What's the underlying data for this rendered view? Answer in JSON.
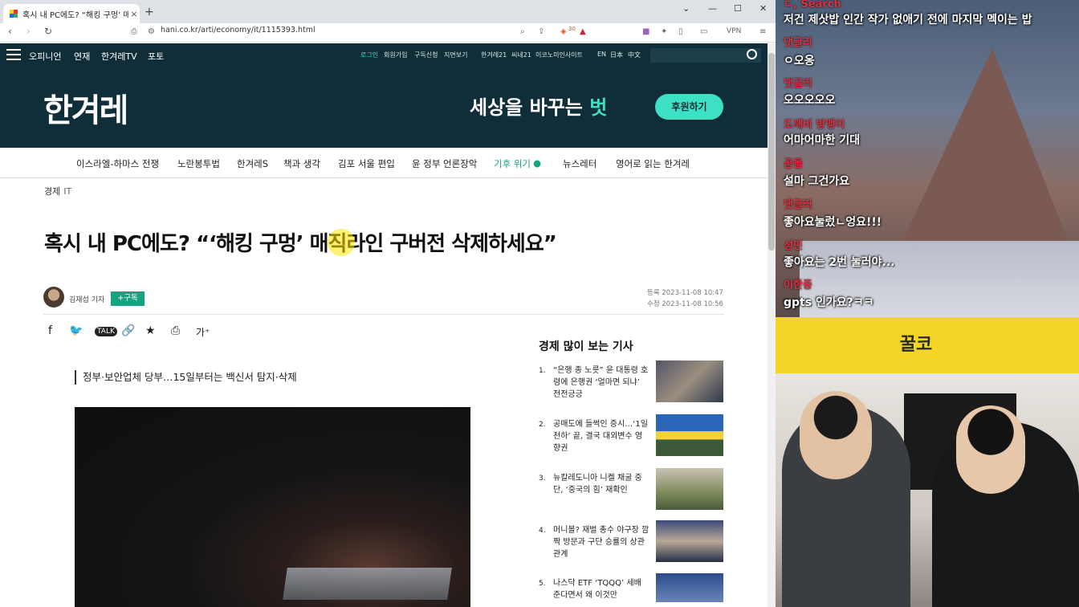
{
  "browser": {
    "tab_title": "혹시 내 PC에도? “해킹 구멍’ 매직…",
    "url": "hani.co.kr/arti/economy/it/1115393.html",
    "vpn": "VPN",
    "shield_count": "30"
  },
  "gnb": {
    "left": [
      "오피니언",
      "연재",
      "한겨레TV",
      "포토"
    ],
    "right": [
      "로그인",
      "회원가입",
      "구독신청",
      "지면보기",
      "한겨레21",
      "씨네21",
      "이코노미인사이트",
      "EN",
      "日本",
      "中文"
    ]
  },
  "masthead": {
    "logo": "한겨레",
    "slogan_pre": "세상을 바꾸는 ",
    "slogan_em": "벗",
    "support": "후원하기"
  },
  "catnav": [
    "이스라엘-하마스 전쟁",
    "노란봉투법",
    "한겨레S",
    "책과 생각",
    "김포 서울 편입",
    "윤 정부 언론장악",
    "기후 위기",
    "뉴스레터",
    "영어로 읽는 한겨레"
  ],
  "article": {
    "section": "경제",
    "subsection": "IT",
    "title": "혹시 내 PC에도? “‘해킹 구멍’ 매직라인 구버전 삭제하세요”",
    "reporter": "김재섭 기자",
    "subscribe": "+구독",
    "registered": "등록 2023-11-08 10:47",
    "modified": "수정 2023-11-08 10:56",
    "subhead": "정부·보안업체 당부…15일부터는 백신서 탐지·삭제",
    "font_btn": "가⁺"
  },
  "sidebar": {
    "title": "경제 많이 보는 기사",
    "items": [
      {
        "n": "1.",
        "t": "“은행 종 노릇” 윤 대통령 호령에 은행권 ‘얼마면 되냐’ 전전긍긍"
      },
      {
        "n": "2.",
        "t": "공매도에 들썩인 증시…‘1일 천하’ 끝, 결국 대외변수 영향권"
      },
      {
        "n": "3.",
        "t": "뉴칼레도니아 니켈 채굴 중단, ‘중국의 힘’ 재확인"
      },
      {
        "n": "4.",
        "t": "머니볼? 재벌 총수 야구장 깜짝 방문과 구단 승률의 상관관계"
      },
      {
        "n": "5.",
        "t": "나스닥 ETF ‘TQQQ’ 세배 준다면서 왜 이것만"
      }
    ]
  },
  "chat": [
    {
      "name": "ㄷ, Search",
      "msg": "저건 제삿밥 인간 작가 없애기 전에 마지막 멕이는 밥"
    },
    {
      "name": "댓글러",
      "msg": "ㅇ오옹"
    },
    {
      "name": "댓글러",
      "msg": "오오오오오"
    },
    {
      "name": "도깨비 방맹이",
      "msg": "어마어마한 기대"
    },
    {
      "name": "곰돌",
      "msg": "설마 그건가요"
    },
    {
      "name": "댓글러",
      "msg": "좋아요눌렀ㄴ엉요!!!"
    },
    {
      "name": "성민",
      "msg": "좋아요는 2번 눌러야..."
    },
    {
      "name": "이한종",
      "msg": "gpts 인가요?ㅋㅋ"
    }
  ],
  "honey_logo": "꿀코"
}
